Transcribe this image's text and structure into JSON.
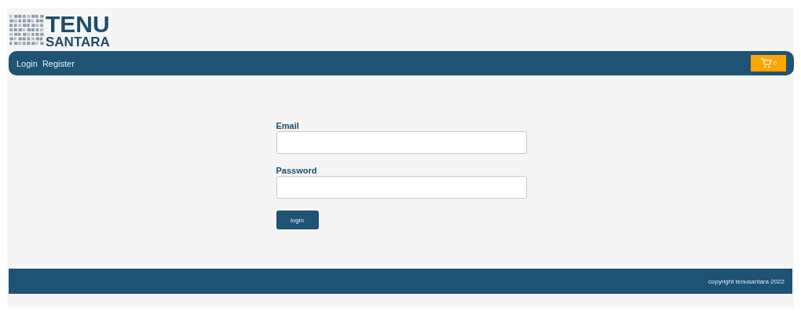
{
  "logo": {
    "line_1": "TENU",
    "line_2": "SANTARA"
  },
  "nav": {
    "links": [
      "Login",
      "Register"
    ],
    "cart_count": "0"
  },
  "form": {
    "fields": [
      {
        "label": "Email"
      },
      {
        "label": "Password"
      }
    ],
    "submit": "login"
  },
  "footer": {
    "text": "copyright tenusantara 2022"
  }
}
